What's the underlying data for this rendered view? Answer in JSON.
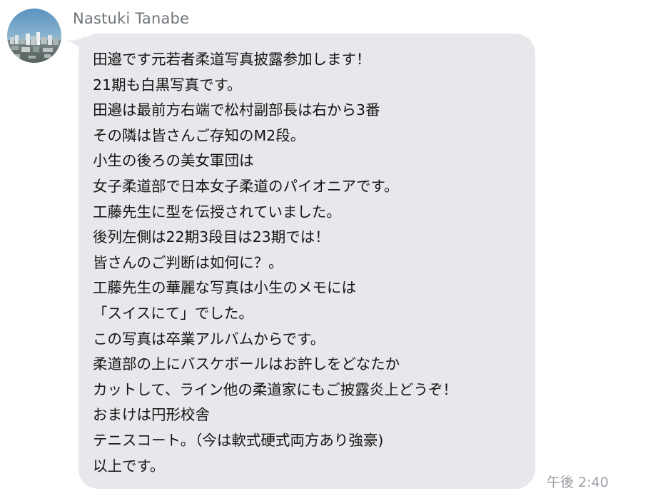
{
  "sender": {
    "name": "Nastuki Tanabe"
  },
  "message": {
    "lines": [
      "田邉です元若者柔道写真披露参加します！",
      "21期も白黒写真です。",
      "田邉は最前方右端で松村副部長は右から3番",
      "その隣は皆さんご存知のM2段。",
      "小生の後ろの美女軍団は",
      "女子柔道部で日本女子柔道のパイオニアです。",
      "工藤先生に型を伝授されていました。",
      "後列左側は22期3段目は23期では！",
      "皆さんのご判断は如何に？。",
      "工藤先生の華麗な写真は小生のメモには",
      "「スイスにて」でした。",
      "この写真は卒業アルバムからです。",
      "柔道部の上にバスケボールはお許しをどなたか",
      "カットして、ライン他の柔道家にもご披露炎上どうぞ！",
      "おまけは円形校舎",
      "テニスコート。（今は軟式硬式両方あり強豪)",
      "以上です。"
    ],
    "timestamp": "午後 2:40"
  },
  "colors": {
    "bubble_background": "#e7e8eb",
    "message_text": "#151515",
    "sender_name": "#6f7479",
    "timestamp": "#9ba0a6"
  },
  "icons": {
    "avatar": "city-skyline-photo-avatar"
  }
}
